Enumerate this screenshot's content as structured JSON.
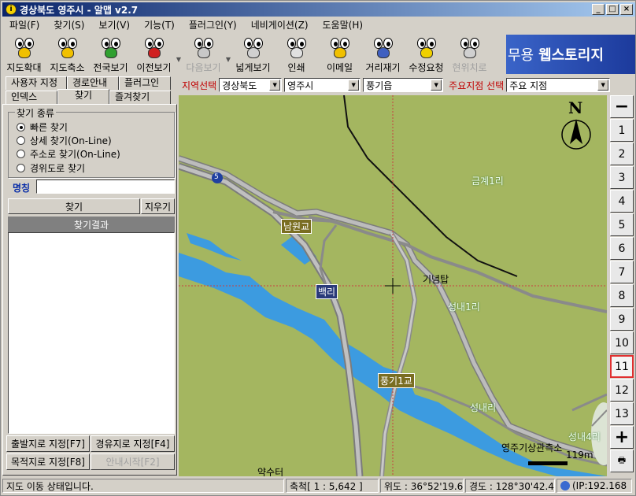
{
  "window": {
    "title": "경상북도 영주시 - 알맵 v2.7",
    "app_icon": "i"
  },
  "menu": [
    "파일(F)",
    "찾기(S)",
    "보기(V)",
    "기능(T)",
    "플러그인(Y)",
    "네비게이션(Z)",
    "도움말(H)"
  ],
  "toolbar": [
    {
      "label": "지도확대",
      "color": "#f0c000"
    },
    {
      "label": "지도축소",
      "color": "#f0c000"
    },
    {
      "label": "전국보기",
      "color": "#30a030"
    },
    {
      "label": "이전보기",
      "color": "#d02020"
    },
    {
      "label": "다음보기",
      "color": "#c8c8c8"
    },
    {
      "label": "넓게보기",
      "color": "#d0d0d0"
    },
    {
      "label": "인쇄",
      "color": "#e0e0e0"
    },
    {
      "label": "이메일",
      "color": "#f0c000"
    },
    {
      "label": "거리재기",
      "color": "#4060c0"
    },
    {
      "label": "수정요청",
      "color": "#f0d000"
    },
    {
      "label": "현위치로",
      "color": "#d0d0d0"
    }
  ],
  "banner": {
    "text": "무용",
    "bold": "웹스토리지"
  },
  "tabs": {
    "row1": [
      "사용자 지정",
      "경로안내",
      "플러그인"
    ],
    "row2": [
      "인덱스",
      "찾기",
      "즐겨찾기"
    ],
    "active": "찾기"
  },
  "search": {
    "group_title": "찾기 종류",
    "options": [
      "빠른 찾기",
      "상세 찾기(On-Line)",
      "주소로 찾기(On-Line)",
      "경위도로 찾기"
    ],
    "selected": "빠른 찾기",
    "name_label": "명칭",
    "name_value": "",
    "find_button": "찾기",
    "clear_button": "지우기",
    "results_header": "찾기결과"
  },
  "route_buttons": {
    "start": "출발지로 지정[F7]",
    "via": "경유지로 지정[F4]",
    "dest": "목적지로 지정[F8]",
    "guide": "안내시작[F2]"
  },
  "region": {
    "label": "지역선택",
    "province": "경상북도",
    "city": "영주시",
    "town": "풍기읍",
    "poi_label": "주요지점 선택",
    "poi_value": "주요 지점"
  },
  "map": {
    "labels": {
      "geumgye": "금계1리",
      "namwon": "남원교",
      "baekri": "백리",
      "ginyeomtap": "기념탑",
      "seongnae1": "성내1리",
      "punggi1": "풍기1교",
      "seongnae": "성내리",
      "seongnae4": "성내4리",
      "weather": "영주기상관측소",
      "yaksu": "약수터",
      "route_no": "5"
    },
    "scale_text": "119m",
    "north": "N"
  },
  "zoom": {
    "levels": [
      "1",
      "2",
      "3",
      "4",
      "5",
      "6",
      "7",
      "8",
      "9",
      "10",
      "11",
      "12",
      "13"
    ],
    "active": "11",
    "minus": "−",
    "plus": "+"
  },
  "status": {
    "state": "지도 이동 상태입니다.",
    "scale": "축척[ 1 : 5,642 ]",
    "lat": "위도 : 36°52'19.63\"",
    "lon": "경도 : 128°30'42.49\"",
    "ip": "(IP:192.168"
  }
}
